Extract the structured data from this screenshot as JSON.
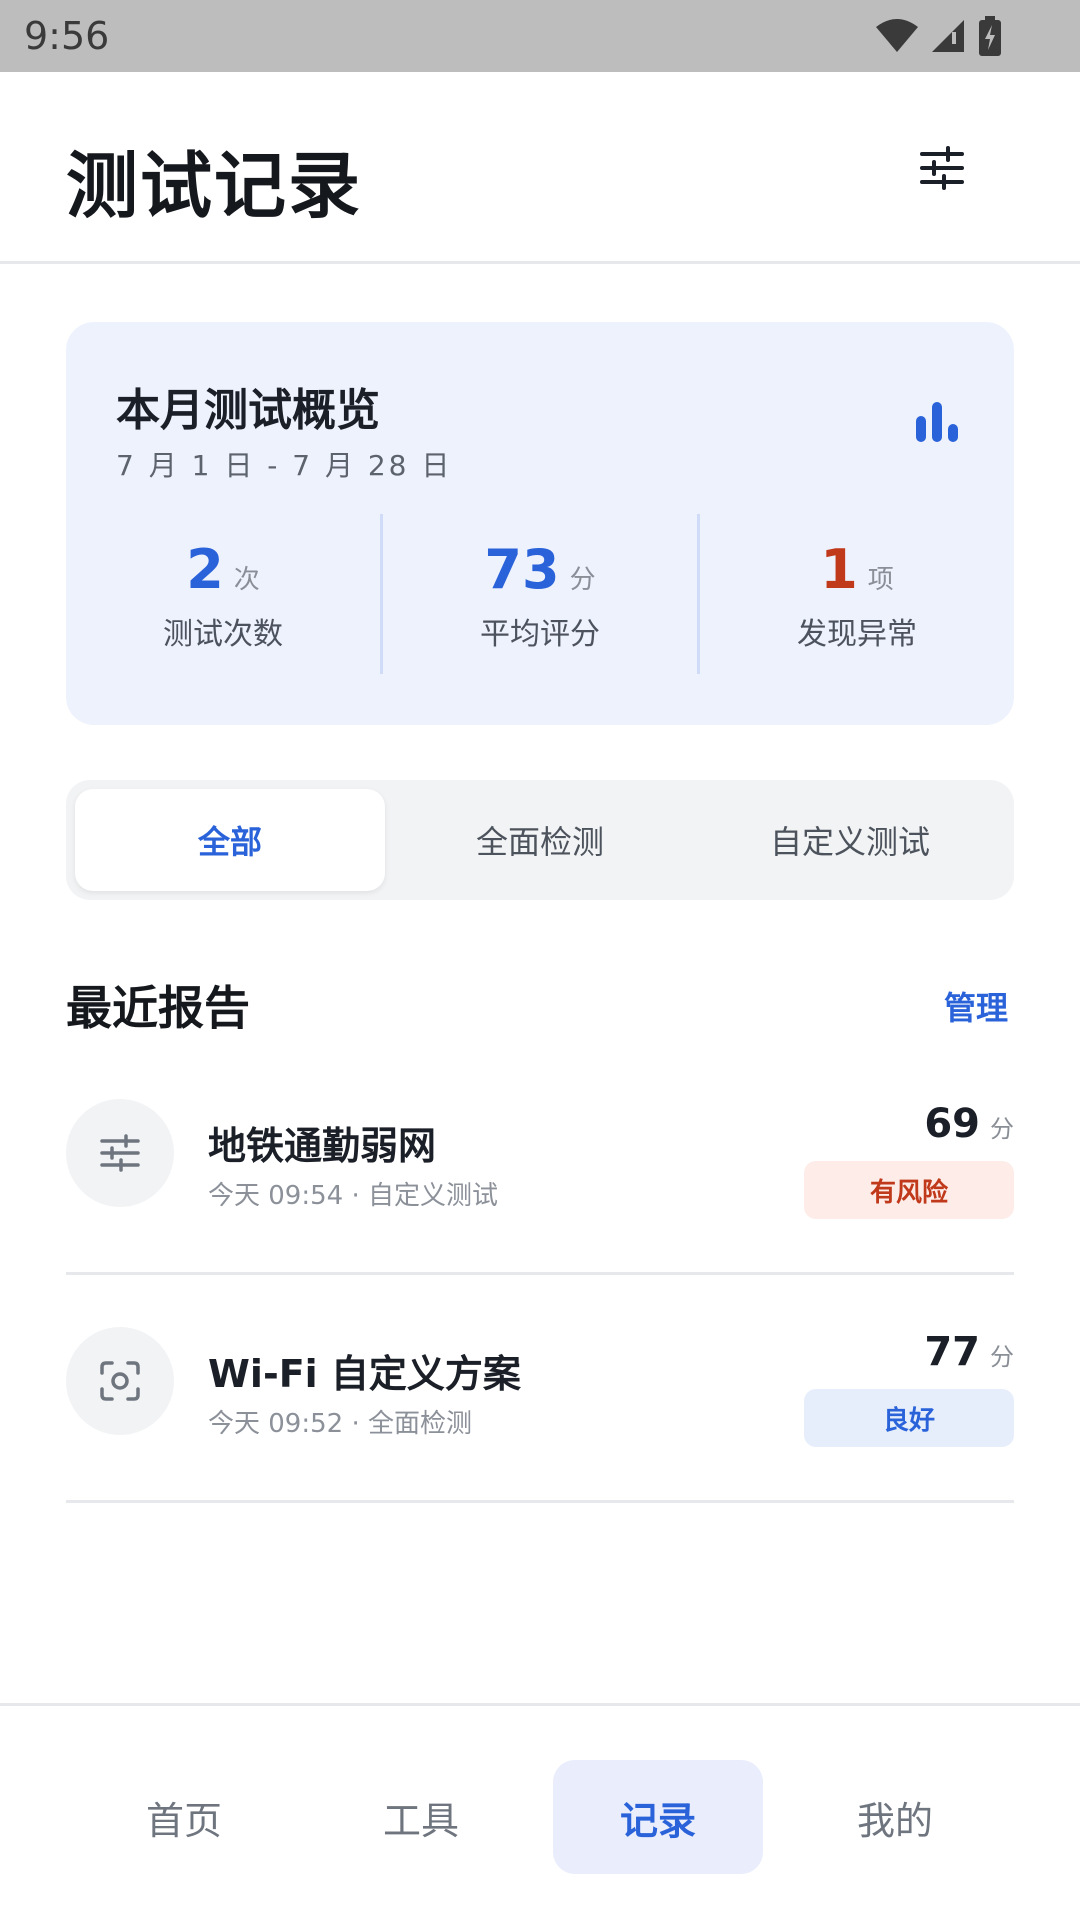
{
  "status_bar": {
    "time": "9:56"
  },
  "header": {
    "title": "测试记录",
    "filter_icon": "sliders-icon"
  },
  "overview": {
    "title": "本月测试概览",
    "date_range": "7 月 1 日 - 7 月 28 日",
    "chart_icon": "bar-chart-icon",
    "stats": [
      {
        "value": "2",
        "unit": "次",
        "label": "测试次数",
        "color": "#2a63d9"
      },
      {
        "value": "73",
        "unit": "分",
        "label": "平均评分",
        "color": "#2a63d9"
      },
      {
        "value": "1",
        "unit": "项",
        "label": "发现异常",
        "color": "#c0391b"
      }
    ]
  },
  "filter_tabs": [
    {
      "label": "全部",
      "active": true
    },
    {
      "label": "全面检测",
      "active": false
    },
    {
      "label": "自定义测试",
      "active": false
    }
  ],
  "recent": {
    "title": "最近报告",
    "action": "管理",
    "items": [
      {
        "name": "地铁通勤弱网",
        "meta": "今天 09:54 · 自定义测试",
        "score": "69",
        "unit": "分",
        "badge": "有风险",
        "badge_color": "#c0391b",
        "badge_bg": "#fdece7",
        "icon": "sliders-icon"
      },
      {
        "name": "Wi-Fi 自定义方案",
        "meta": "今天 09:52 · 全面检测",
        "score": "77",
        "unit": "分",
        "badge": "良好",
        "badge_color": "#2a63d9",
        "badge_bg": "#e6eefc",
        "icon": "scan-icon"
      }
    ]
  },
  "bottom_nav": [
    {
      "label": "首页",
      "active": false
    },
    {
      "label": "工具",
      "active": false
    },
    {
      "label": "记录",
      "active": true
    },
    {
      "label": "我的",
      "active": false
    }
  ]
}
